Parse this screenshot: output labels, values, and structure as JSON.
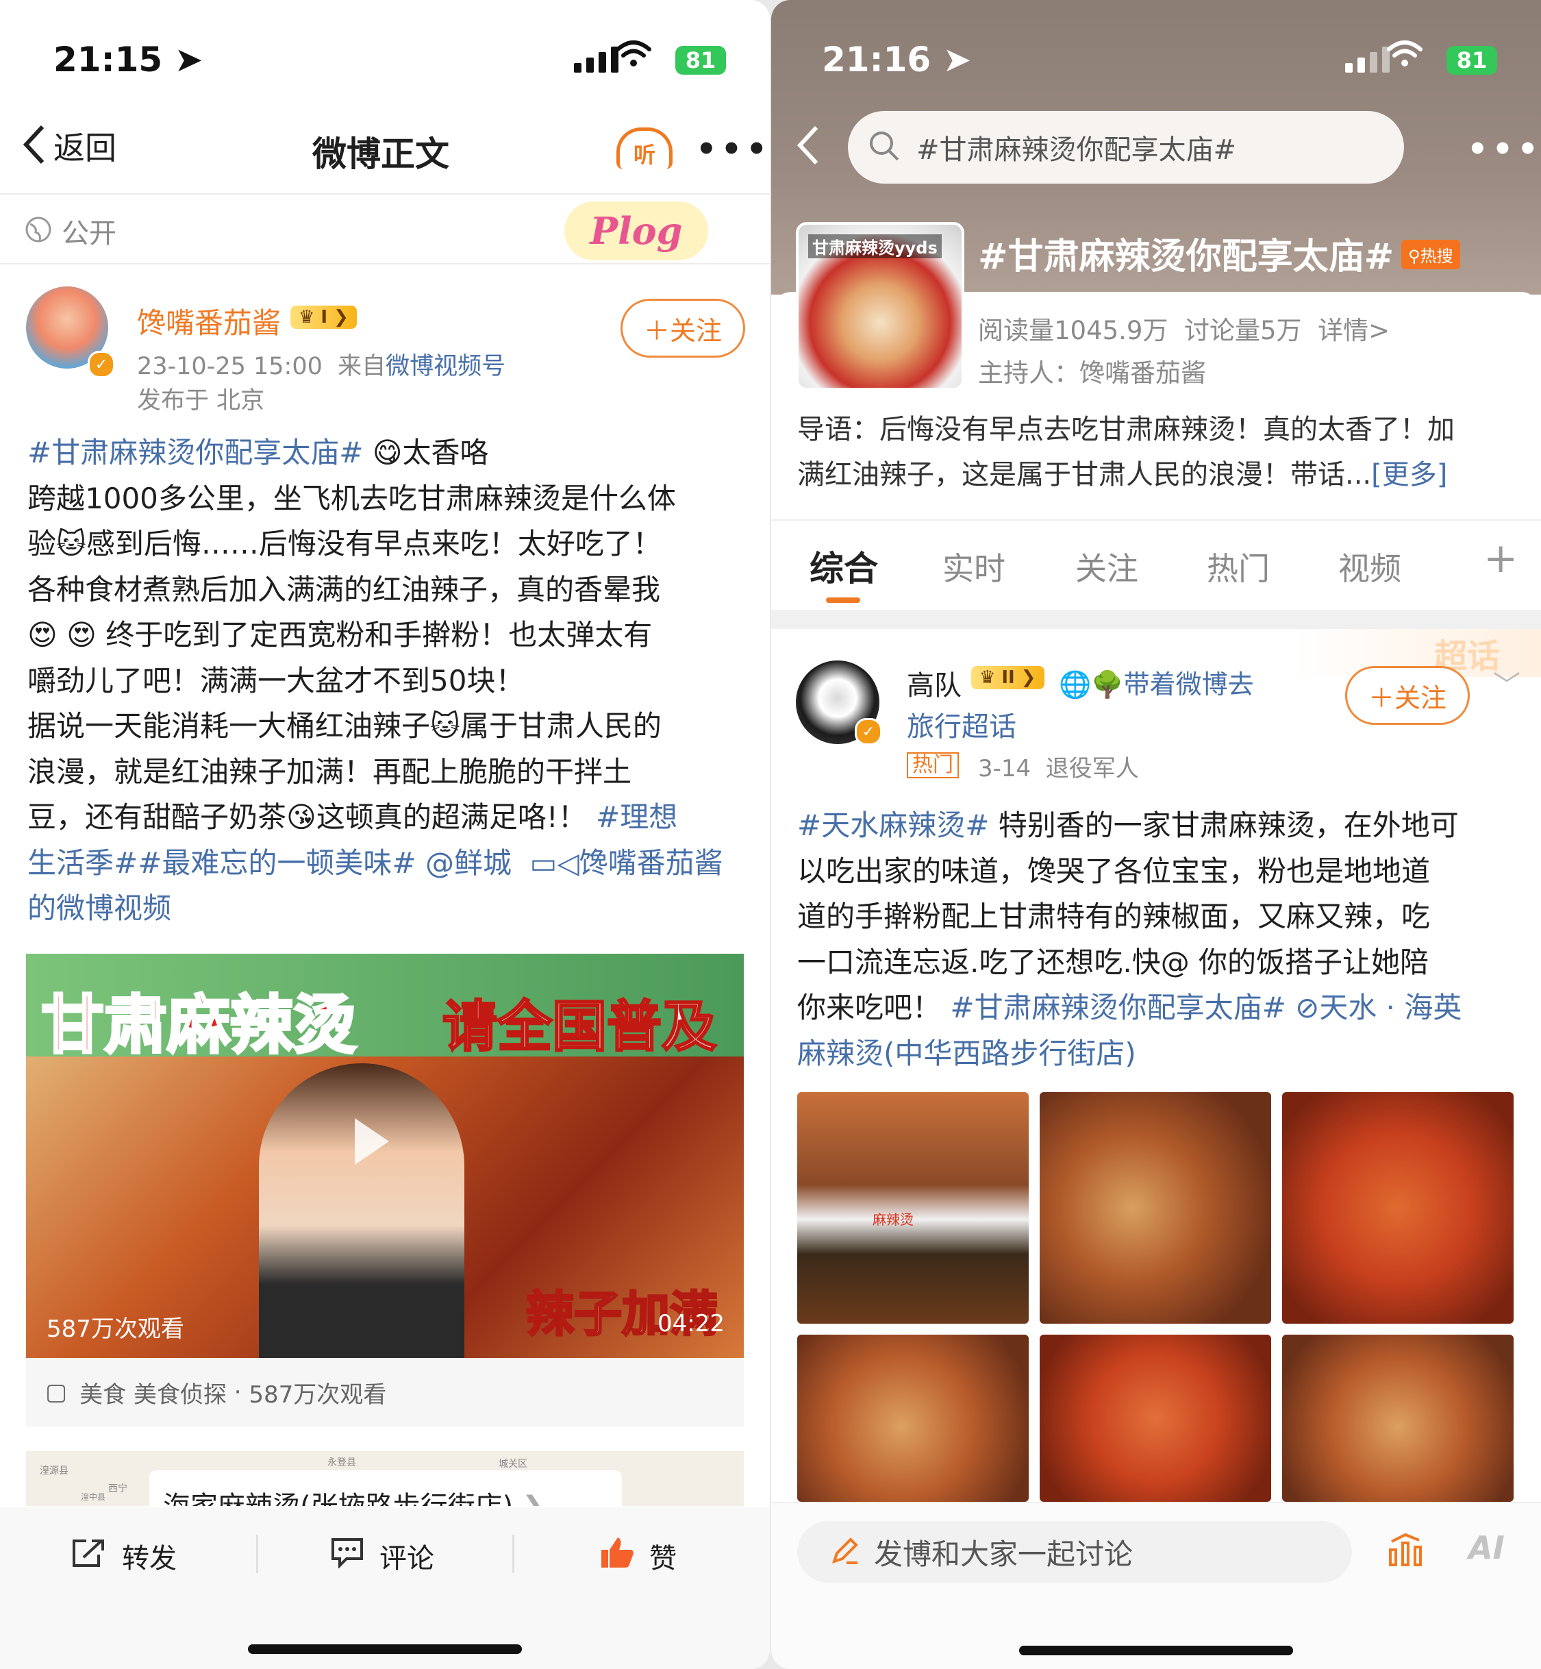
{
  "left": {
    "status": {
      "time": "21:15",
      "battery": "81"
    },
    "nav": {
      "back": "返回",
      "title": "微博正文",
      "listen": "听"
    },
    "visibility": "公开",
    "sticker": "Plog",
    "author": {
      "name": "馋嘴番茄酱",
      "level": "I",
      "time": "23-10-25 15:00",
      "from_prefix": "来自",
      "from_link": "微博视频号",
      "location": "发布于 北京",
      "follow": "＋关注"
    },
    "post": {
      "hashtag1": "#甘肃麻辣烫你配享太庙#",
      "t1": "太香咯",
      "l2": "跨越1000多公里，坐飞机去吃甘肃麻辣烫是什么体",
      "l3": "验",
      "l3b": "感到后悔……后悔没有早点来吃！太好吃了！",
      "l4": "各种食材煮熟后加入满满的红油辣子，真的香晕我",
      "l5": "终于吃到了定西宽粉和手擀粉！也太弹太有",
      "l6": "嚼劲儿了吧！满满一大盆才不到50块！",
      "l7": "据说一天能消耗一大桶红油辣子",
      "l7b": "属于甘肃人民的",
      "l8": "浪漫，就是红油辣子加满！再配上脆脆的干拌土",
      "l9": "豆，还有甜醅子奶茶",
      "l9b": "这顿真的超满足咯!！",
      "hashtag2": "#理想",
      "l10a": "生活季##最难忘的一顿美味#",
      "mention": "@鲜城",
      "videolink": "馋嘴番茄酱",
      "l11": "的微博视频"
    },
    "video": {
      "title1": "甘肃麻辣烫",
      "title2": "请全国普及",
      "bottom": "辣子加满",
      "views": "587万次观看",
      "duration": "04:22"
    },
    "video_meta": {
      "tags": "美食 美食侦探",
      "dot": "·",
      "views": "587万次观看"
    },
    "map": {
      "place": "海家麻辣烫(张掖路步行街店)",
      "labels": [
        "湟源县",
        "永登县",
        "西宁",
        "湟中县",
        "城关区"
      ]
    },
    "actions": {
      "repost": "转发",
      "comment": "评论",
      "like": "赞"
    }
  },
  "right": {
    "status": {
      "time": "21:16",
      "battery": "81"
    },
    "search": {
      "value": "#甘肃麻辣烫你配享太庙#"
    },
    "topic": {
      "thumb_label": "甘肃麻辣烫yyds",
      "title": "#甘肃麻辣烫你配享太庙#",
      "hot_badge": "热搜",
      "reads": "阅读量1045.9万",
      "discuss": "讨论量5万",
      "detail": "详情>",
      "host": "主持人：馋嘴番茄酱"
    },
    "intro": {
      "l1": "导语：后悔没有早点去吃甘肃麻辣烫！真的太香了！加",
      "l2": "满红油辣子，这是属于甘肃人民的浪漫！带话...",
      "more": "[更多]"
    },
    "tabs": [
      "综合",
      "实时",
      "关注",
      "热门",
      "视频"
    ],
    "tab_add": "+",
    "post": {
      "author": "高队",
      "level": "II",
      "tag1": "带着微博去",
      "tag2": "旅行超话",
      "hot": "热门",
      "date": "3-14",
      "role": "退役军人",
      "follow": "＋关注",
      "banner": "超话",
      "hashtag1": "#天水麻辣烫#",
      "l1": "特别香的一家甘肃麻辣烫，在外地可",
      "l2": "以吃出家的味道，馋哭了各位宝宝，粉也是地地道",
      "l3": "道的手擀粉配上甘肃特有的辣椒面，又麻又辣，吃",
      "l4": "一口流连忘返.吃了还想吃.快@ 你的饭搭子让她陪",
      "l5": "你来吃吧！",
      "hashtag2": "#甘肃麻辣烫你配享太庙#",
      "loc1": "天水 · 海英",
      "loc2": "麻辣烫(中华西路步行街店)",
      "bowl_text": "麻辣烫"
    },
    "bottom": {
      "placeholder": "发博和大家一起讨论",
      "ai": "AI"
    }
  }
}
